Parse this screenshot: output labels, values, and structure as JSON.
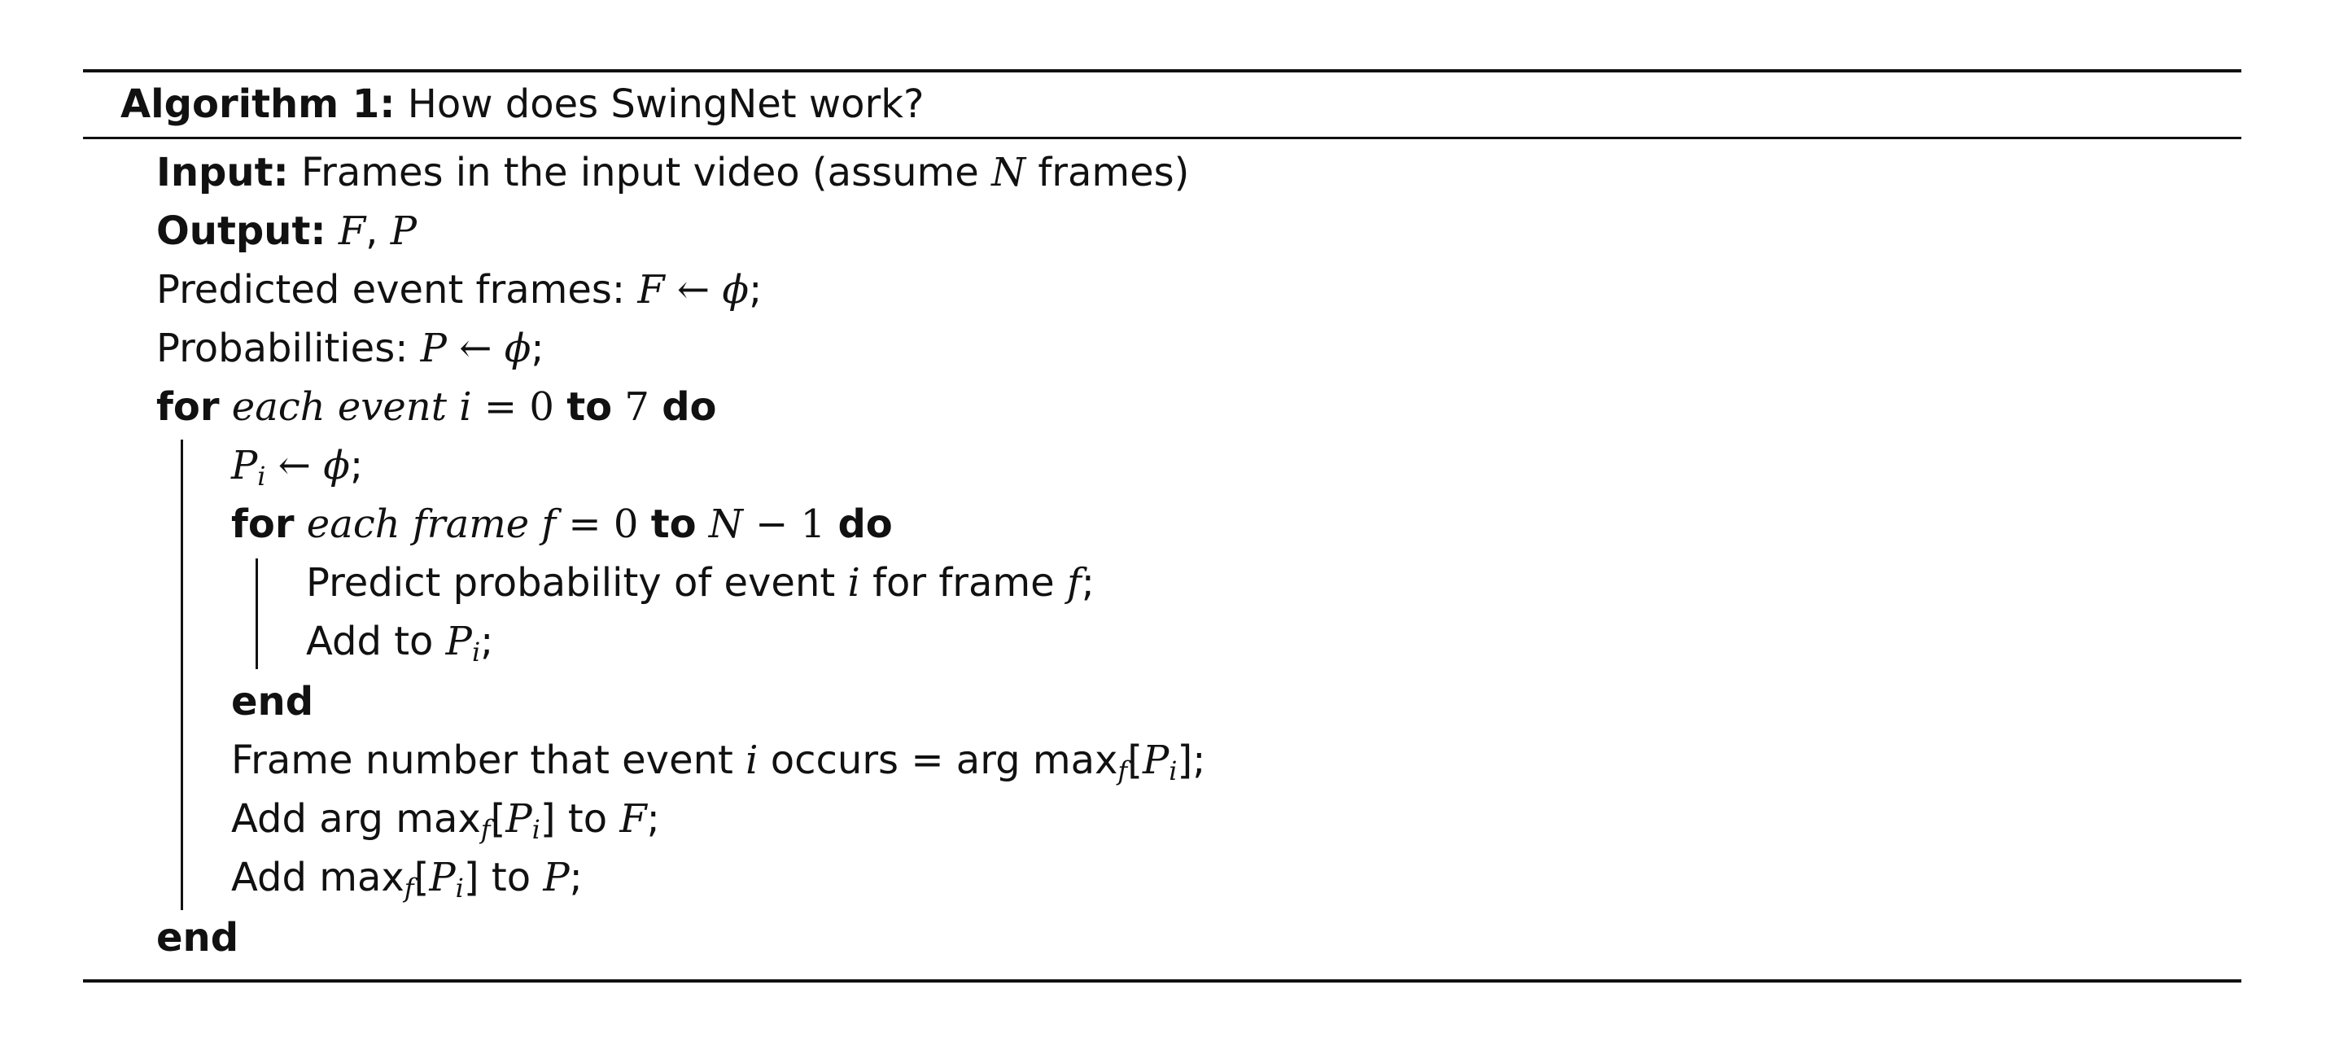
{
  "algorithm": {
    "label": "Algorithm 1:",
    "title": "How does SwingNet work?"
  },
  "lines": {
    "input_kw": "Input:",
    "input_text_a": "Frames in the input video (assume",
    "input_N": "N",
    "input_text_b": "frames)",
    "output_kw": "Output:",
    "output_F": "F",
    "output_sep": ", ",
    "output_P": "P",
    "pred_text": "Predicted event frames:",
    "pred_F": "F",
    "pred_arrow": "←",
    "pred_phi": "ϕ",
    "pred_semi": ";",
    "prob_text": "Probabilities:",
    "prob_P": "P",
    "prob_arrow": "←",
    "prob_phi": "ϕ",
    "prob_semi": ";",
    "for1_kw": "for",
    "for1_cond": "each event",
    "for1_i": "i",
    "for1_eq": "= 0",
    "for1_to": "to",
    "for1_end": "7",
    "for1_do": "do",
    "pi_P": "P",
    "pi_sub": "i",
    "pi_arrow": "←",
    "pi_phi": "ϕ",
    "pi_semi": ";",
    "for2_kw": "for",
    "for2_cond": "each frame",
    "for2_f": "f",
    "for2_eq": "= 0",
    "for2_to": "to",
    "for2_N": "N",
    "for2_minus": "− 1",
    "for2_do": "do",
    "predict_text_a": "Predict probability of event",
    "predict_i": "i",
    "predict_text_b": "for frame",
    "predict_f": "f",
    "predict_semi": ";",
    "add_text": "Add to",
    "add_P": "P",
    "add_sub": "i",
    "add_semi": ";",
    "end_inner": "end",
    "frame_text_a": "Frame number that event",
    "frame_i": "i",
    "frame_text_b": "occurs = arg max",
    "frame_sub_f": "f",
    "frame_br_open": "[",
    "frame_P": "P",
    "frame_sub_i": "i",
    "frame_br_close": "];",
    "addF_text_a": "Add arg max",
    "addF_sub_f": "f",
    "addF_br_open": "[",
    "addF_P": "P",
    "addF_sub_i": "i",
    "addF_br_close": "]",
    "addF_to": "to",
    "addF_F": "F",
    "addF_semi": ";",
    "addP_text_a": "Add max",
    "addP_sub_f": "f",
    "addP_br_open": "[",
    "addP_P": "P",
    "addP_sub_i": "i",
    "addP_br_close": "]",
    "addP_to": "to",
    "addP_P2": "P",
    "addP_semi": ";",
    "end_outer": "end"
  }
}
